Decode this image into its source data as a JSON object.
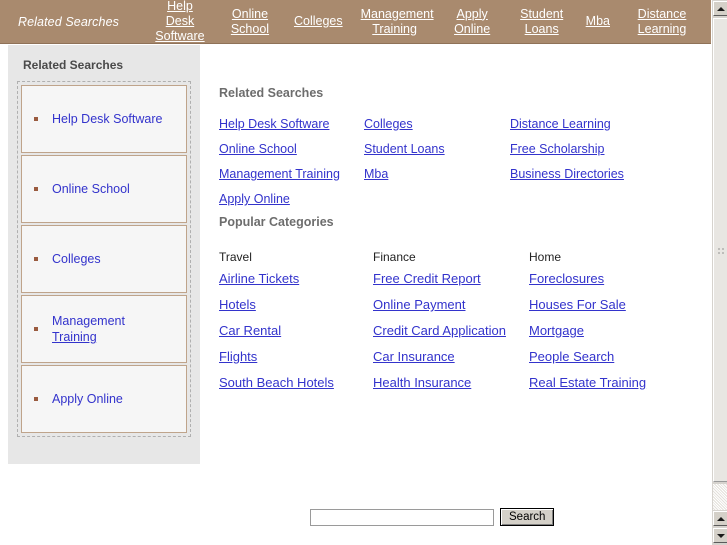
{
  "topbar": {
    "title": "Related Searches",
    "bg_color": "#a98a6e",
    "links": [
      {
        "label": "Help Desk Software"
      },
      {
        "label": "Online School"
      },
      {
        "label": "Colleges"
      },
      {
        "label": "Management Training"
      },
      {
        "label": "Apply Online"
      },
      {
        "label": "Student Loans"
      },
      {
        "label": "Mba"
      },
      {
        "label": "Distance Learning"
      }
    ]
  },
  "sidebar": {
    "title": "Related Searches",
    "bg_color": "#e7e7e7",
    "bullet_color": "#9a5b3f",
    "link_color": "#3333cc",
    "items": [
      {
        "label": "Help Desk Software",
        "line1": "Help Desk Software",
        "line2": ""
      },
      {
        "label": "Online School",
        "line1": "Online School",
        "line2": ""
      },
      {
        "label": "Colleges",
        "line1": "Colleges",
        "line2": ""
      },
      {
        "label": "Management Training",
        "line1": "Management",
        "line2": "Training"
      },
      {
        "label": "Apply Online",
        "line1": "Apply Online",
        "line2": ""
      }
    ]
  },
  "main": {
    "related": {
      "heading": "Related Searches",
      "columns": [
        [
          "Help Desk Software",
          "Online School",
          "Management Training",
          "Apply Online"
        ],
        [
          "Colleges",
          "Student Loans",
          "Mba"
        ],
        [
          "Distance Learning",
          "Free Scholarship",
          "Business Directories"
        ]
      ]
    },
    "popular": {
      "heading": "Popular Categories",
      "columns": [
        {
          "heading": "Travel",
          "links": [
            "Airline Tickets",
            "Hotels",
            "Car Rental",
            "Flights",
            "South Beach Hotels"
          ]
        },
        {
          "heading": "Finance",
          "links": [
            "Free Credit Report",
            "Online Payment",
            "Credit Card Application",
            "Car Insurance",
            "Health Insurance"
          ]
        },
        {
          "heading": "Home",
          "links": [
            "Foreclosures",
            "Houses For Sale",
            "Mortgage",
            "People Search",
            "Real Estate Training"
          ]
        }
      ]
    }
  },
  "search": {
    "value": "",
    "placeholder": "",
    "button_label": "Search"
  },
  "scrollbar": {
    "up_arrow_icon": "scroll-up-icon",
    "down_arrow_icon": "scroll-down-icon"
  }
}
